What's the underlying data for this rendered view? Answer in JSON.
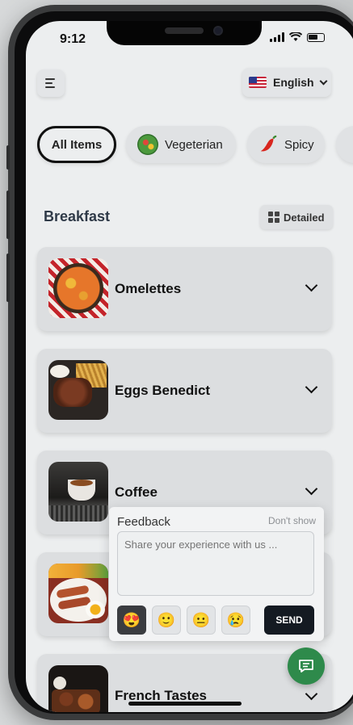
{
  "status_bar": {
    "time": "9:12"
  },
  "header": {
    "language_label": "English"
  },
  "filters": [
    {
      "label": "All Items",
      "icon": "list-icon"
    },
    {
      "label": "Vegeterian",
      "icon": "salad-icon"
    },
    {
      "label": "Spicy",
      "icon": "chili-pepper-icon"
    }
  ],
  "section": {
    "title": "Breakfast",
    "view_toggle_label": "Detailed"
  },
  "menu_items": [
    {
      "name": "Omelettes"
    },
    {
      "name": "Eggs Benedict"
    },
    {
      "name": "Coffee"
    },
    {
      "name": ""
    },
    {
      "name": "French Tastes"
    }
  ],
  "feedback": {
    "title": "Feedback",
    "dismiss_label": "Don't show",
    "placeholder": "Share your experience with us ...",
    "ratings": [
      "😍",
      "🙂",
      "😐",
      "😢"
    ],
    "send_label": "SEND"
  },
  "colors": {
    "accent_green": "#2e8a4b",
    "send_dark": "#141a22"
  }
}
